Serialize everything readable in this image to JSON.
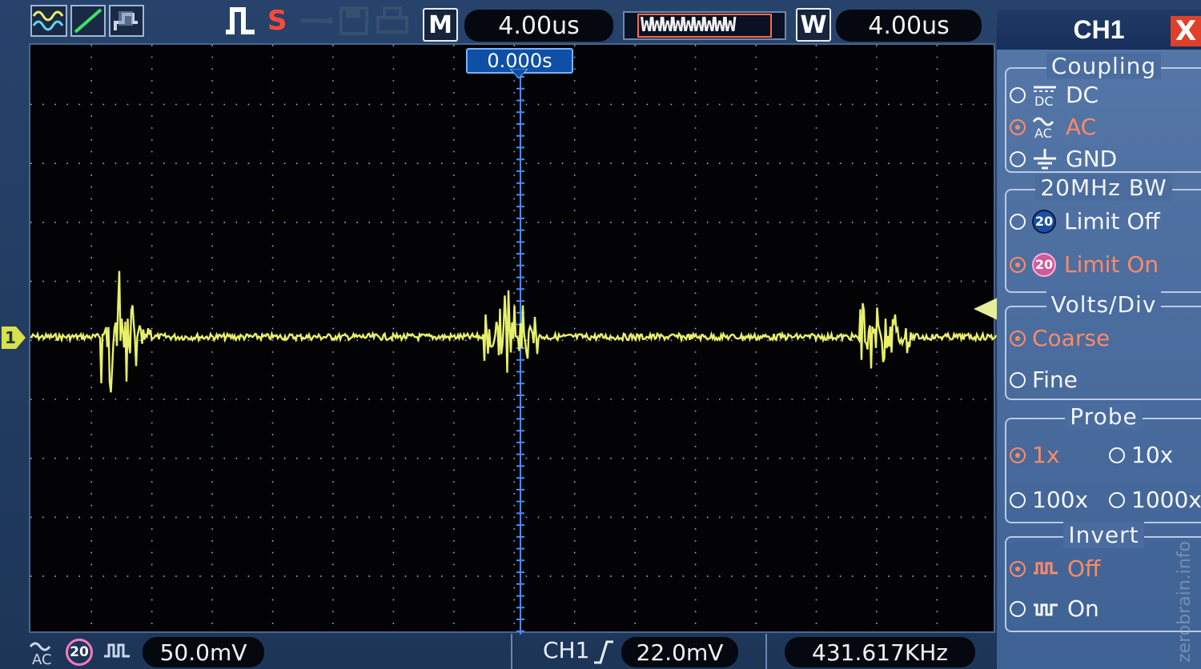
{
  "topbar": {
    "mode_label": "M",
    "timebase": "4.00us",
    "window_label": "W",
    "window_timebase": "4.00us",
    "trigger_state": "S",
    "memory_waveform_label": "WWWWWWWWW"
  },
  "grid": {
    "trigger_position": "0.000s",
    "channel_marker": "1"
  },
  "bottombar": {
    "volts_div": "50.0mV",
    "bw_badge": "20",
    "trigger_source": "CH1",
    "trigger_level": "22.0mV",
    "frequency": "431.617KHz"
  },
  "panel": {
    "title": "CH1",
    "close_label": "X",
    "coupling": {
      "title": "Coupling",
      "options": [
        {
          "label": "DC",
          "icon": "dc-coupling-icon",
          "selected": false
        },
        {
          "label": "AC",
          "icon": "ac-coupling-icon",
          "selected": true
        },
        {
          "label": "GND",
          "icon": "ground-icon",
          "selected": false
        }
      ]
    },
    "bandwidth": {
      "title": "20MHz BW",
      "options": [
        {
          "label": "Limit Off",
          "icon": "bw-20-icon",
          "selected": false
        },
        {
          "label": "Limit On",
          "icon": "bw-20-icon",
          "selected": true
        }
      ]
    },
    "volts_div": {
      "title": "Volts/Div",
      "options": [
        {
          "label": "Coarse",
          "selected": true
        },
        {
          "label": "Fine",
          "selected": false
        }
      ]
    },
    "probe": {
      "title": "Probe",
      "options": [
        {
          "label": "1x",
          "selected": true
        },
        {
          "label": "10x",
          "selected": false
        },
        {
          "label": "100x",
          "selected": false
        },
        {
          "label": "1000x",
          "selected": false
        }
      ]
    },
    "invert": {
      "title": "Invert",
      "options": [
        {
          "label": "Off",
          "icon": "normal-wave-icon",
          "selected": true
        },
        {
          "label": "On",
          "icon": "inverted-wave-icon",
          "selected": false
        }
      ]
    }
  },
  "watermark": "zerobrain.info",
  "colors": {
    "trace": "#e8f06a",
    "grid_dots": "#8fb4e6",
    "selected_option": "#ff8a66",
    "panel_bg": "#4a6c9e"
  }
}
